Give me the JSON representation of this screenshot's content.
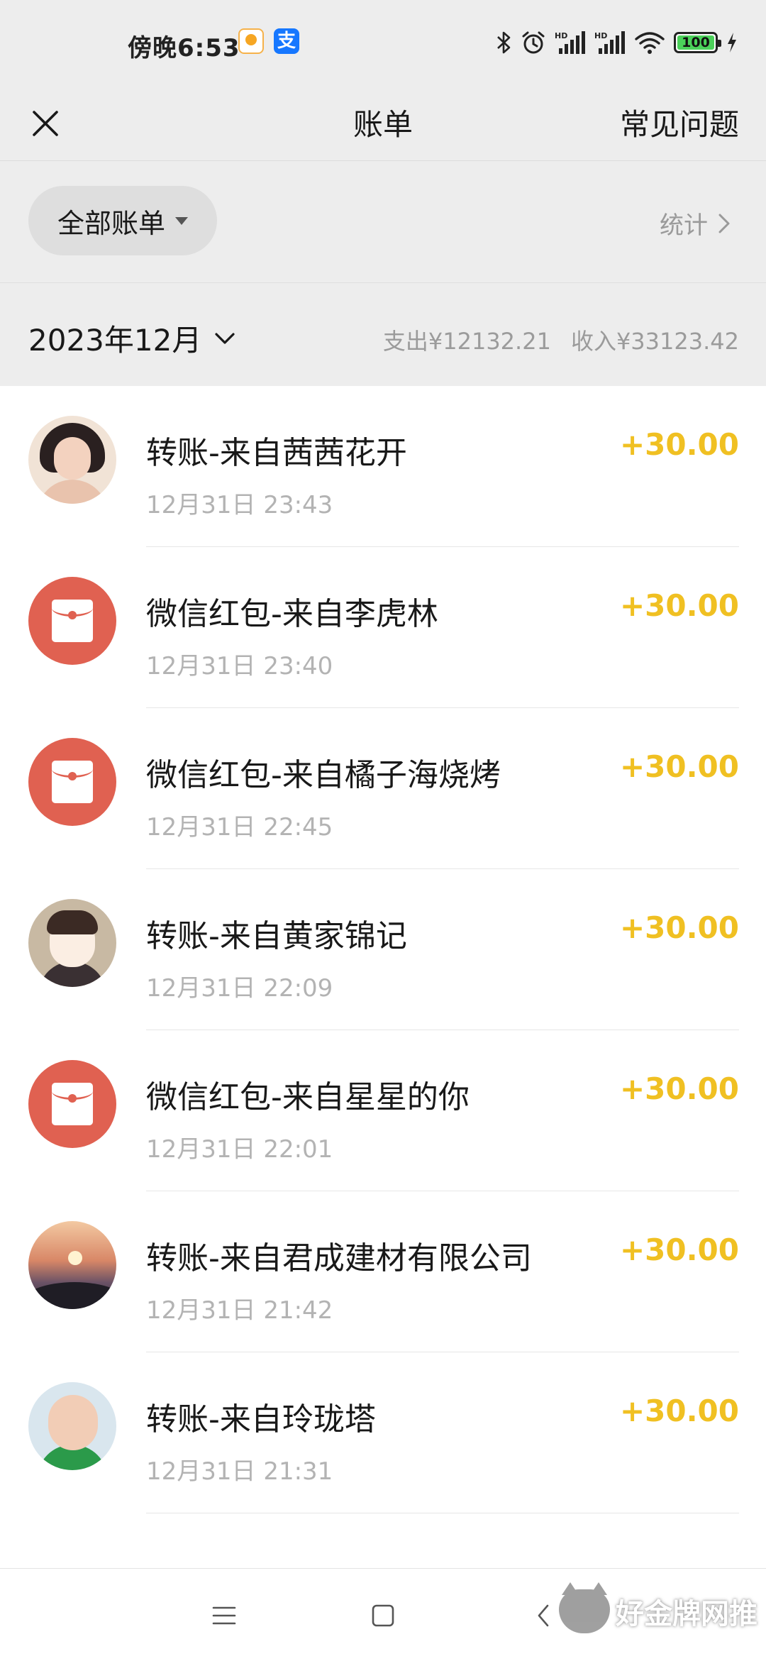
{
  "status_bar": {
    "time": "傍晚6:53",
    "alipay_glyph": "支",
    "battery": "100",
    "icons": [
      "taobao-icon",
      "alipay-icon",
      "bluetooth-icon",
      "alarm-icon",
      "signal-hd-icon",
      "signal-hd-icon",
      "wifi-icon",
      "battery-icon",
      "charging-icon"
    ]
  },
  "header": {
    "title": "账单",
    "faq_label": "常见问题",
    "close_icon": "close-icon"
  },
  "filter": {
    "label": "全部账单",
    "stats_label": "统计"
  },
  "month": {
    "label": "2023年12月",
    "expense": "支出¥12132.21",
    "income": "收入¥33123.42"
  },
  "transactions": [
    {
      "title": "转账-来自茜茜花开",
      "time": "12月31日 23:43",
      "amount": "+30.00",
      "avatar": "girl-photo"
    },
    {
      "title": "微信红包-来自李虎林",
      "time": "12月31日 23:40",
      "amount": "+30.00",
      "avatar": "red-packet-icon"
    },
    {
      "title": "微信红包-来自橘子海烧烤",
      "time": "12月31日 22:45",
      "amount": "+30.00",
      "avatar": "red-packet-icon"
    },
    {
      "title": "转账-来自黄家锦记",
      "time": "12月31日 22:09",
      "amount": "+30.00",
      "avatar": "cartoon-boy"
    },
    {
      "title": "微信红包-来自星星的你",
      "time": "12月31日 22:01",
      "amount": "+30.00",
      "avatar": "red-packet-icon"
    },
    {
      "title": "转账-来自君成建材有限公司",
      "time": "12月31日 21:42",
      "amount": "+30.00",
      "avatar": "sunset-photo"
    },
    {
      "title": "转账-来自玲珑塔",
      "time": "12月31日 21:31",
      "amount": "+30.00",
      "avatar": "baby-photo"
    }
  ],
  "colors": {
    "amount": "#f0c022",
    "red_packet": "#e06151",
    "background": "#ededed"
  },
  "watermark": "好金牌网推"
}
